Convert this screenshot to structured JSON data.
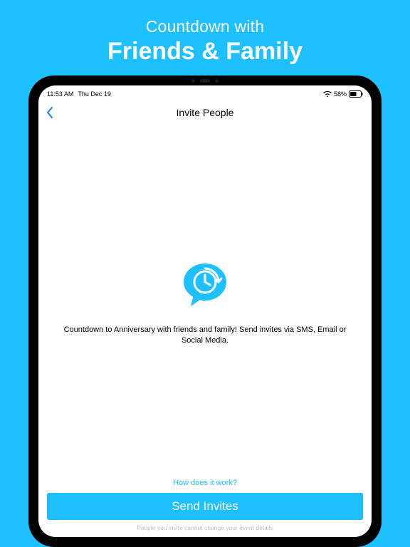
{
  "promo": {
    "line1": "Countdown with",
    "line2": "Friends & Family"
  },
  "status": {
    "time": "11:53 AM",
    "date": "Thu Dec 19",
    "battery_pct": "58%"
  },
  "nav": {
    "title": "Invite People"
  },
  "content": {
    "description": "Countdown to Anniversary with friends and family! Send invites via SMS, Email or Social Media."
  },
  "footer": {
    "how_link": "How does it work?",
    "send_label": "Send Invites",
    "hint": "People you invite cannot change your event details"
  },
  "colors": {
    "accent": "#1ec0ff"
  }
}
